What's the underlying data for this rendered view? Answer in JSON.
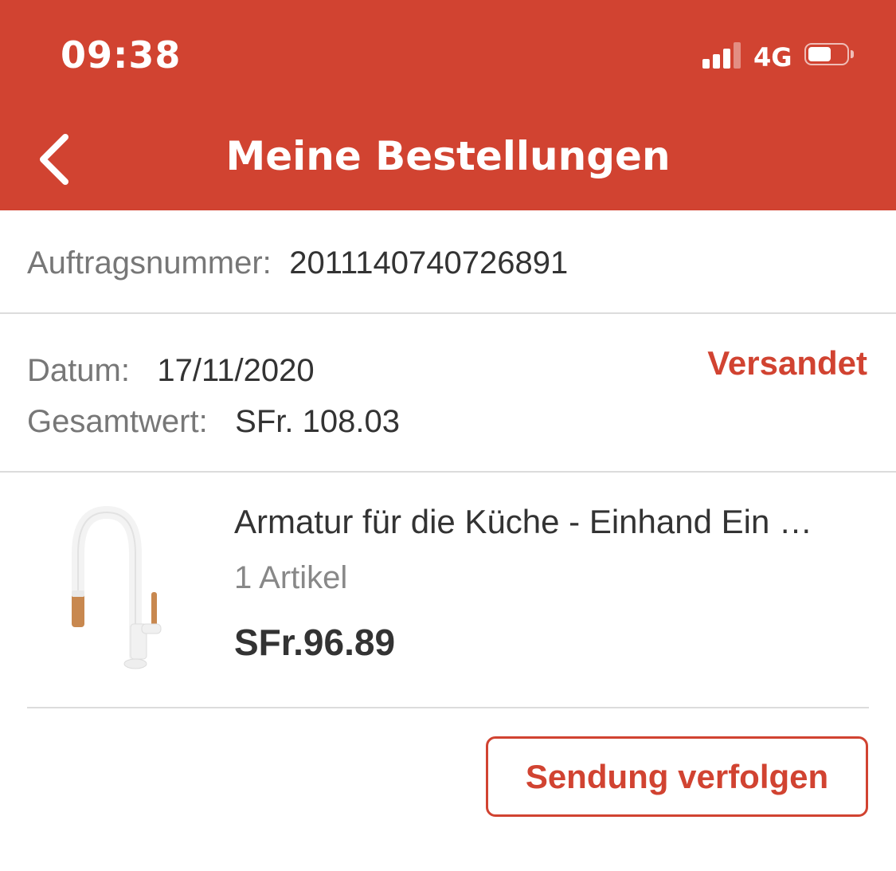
{
  "status_bar": {
    "time": "09:38",
    "network": "4G",
    "signal_bars_active": 3,
    "signal_bars_total": 4,
    "battery_level": 0.5
  },
  "header": {
    "back_icon": "chevron-left-icon",
    "title": "Meine Bestellungen",
    "background_color": "#d14331"
  },
  "order": {
    "number_label": "Auftragsnummer:",
    "number_value": "2011140740726891",
    "date_label": "Datum:",
    "date_value": "17/11/2020",
    "total_label": "Gesamtwert:",
    "total_value": "SFr. 108.03",
    "status": "Versandet",
    "status_color": "#d14331"
  },
  "items": [
    {
      "image_icon": "kitchen-faucet-image",
      "name": "Armatur für die Küche - Einhand Ein …",
      "quantity": "1 Artikel",
      "price": "SFr.96.89"
    }
  ],
  "actions": {
    "track_label": "Sendung verfolgen"
  }
}
